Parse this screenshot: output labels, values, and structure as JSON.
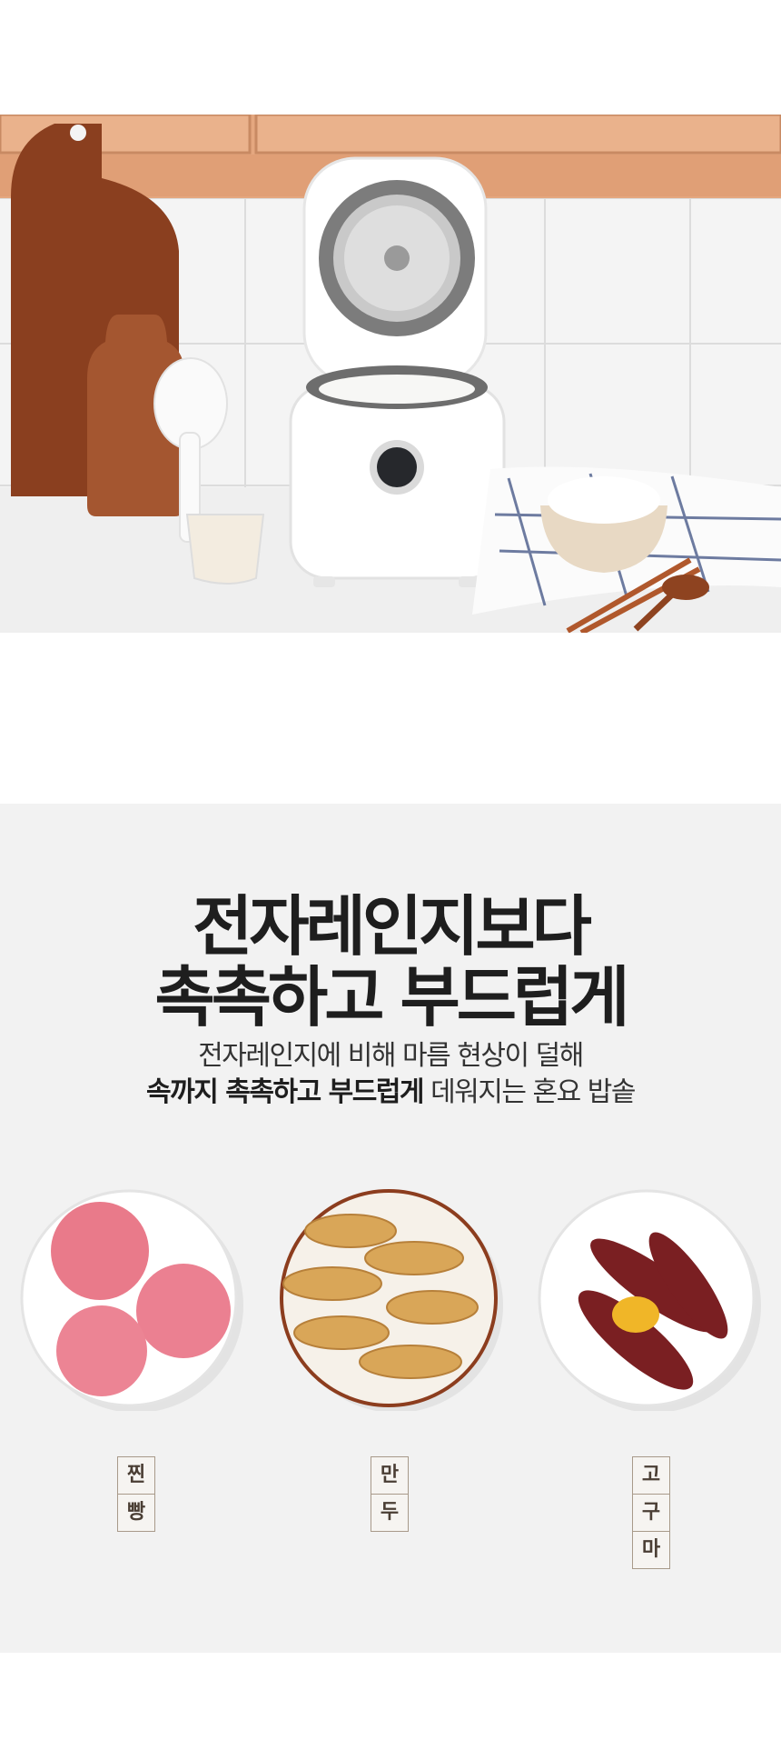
{
  "headline": {
    "line1": "전자레인지보다",
    "line2": "촉촉하고 부드럽게"
  },
  "subtext": {
    "line1": "전자레인지에 비해 마름 현상이 덜해",
    "line2_bold": "속까지 촉촉하고 부드럽게",
    "line2_rest": " 데워지는 혼요 밥솥"
  },
  "foods": [
    {
      "name": "찐빵",
      "chars": [
        "찐",
        "빵"
      ],
      "icon": "steamed-bun-plate"
    },
    {
      "name": "만두",
      "chars": [
        "만",
        "두"
      ],
      "icon": "dumpling-plate"
    },
    {
      "name": "고구마",
      "chars": [
        "고",
        "구",
        "마"
      ],
      "icon": "sweet-potato-plate"
    }
  ],
  "colors": {
    "section_bg": "#f2f2f2",
    "headline": "#1e1e1e",
    "label_border": "#a89a8a",
    "label_text": "#4a3e34"
  }
}
